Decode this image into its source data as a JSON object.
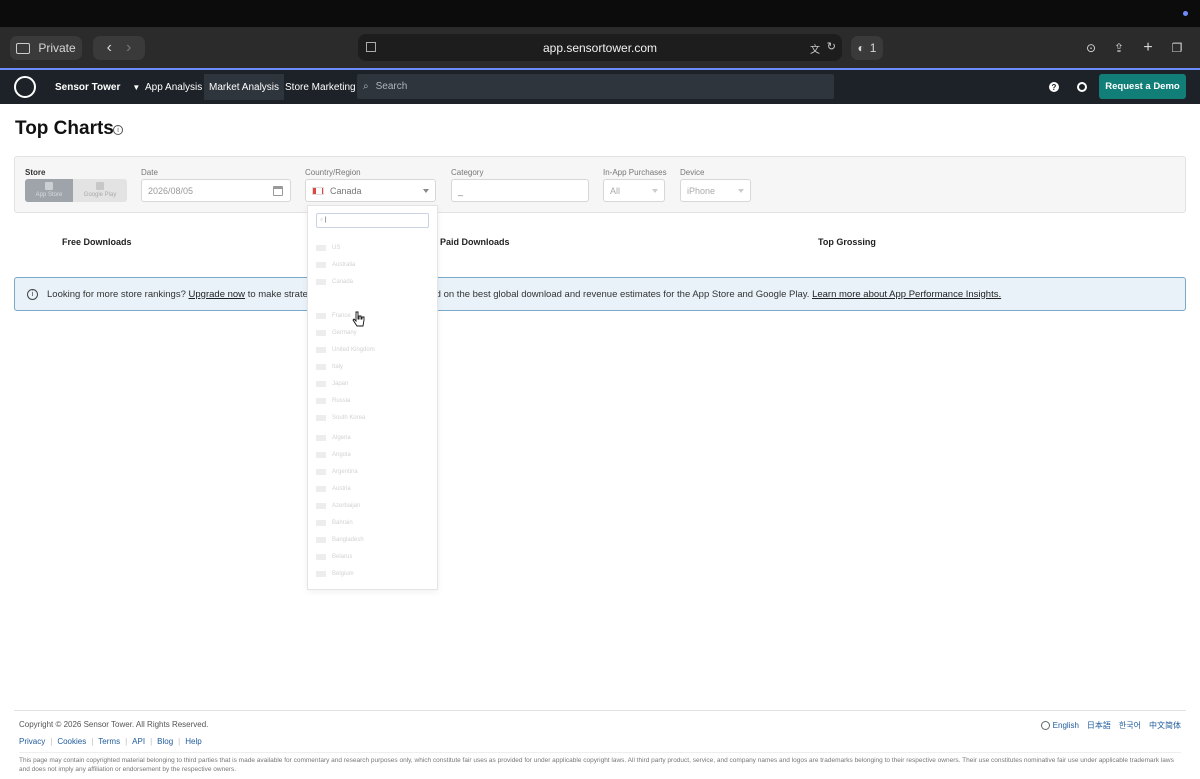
{
  "browser": {
    "private_label": "Private",
    "url": "app.sensortower.com",
    "tab_count": "1"
  },
  "nav": {
    "brand": "Sensor Tower",
    "items": [
      "App Analysis",
      "Market Analysis",
      "Store Marketing"
    ],
    "search_placeholder": "Search",
    "demo_button": "Request a Demo"
  },
  "page": {
    "title": "Top Charts"
  },
  "filters": {
    "store_label": "Store",
    "store_options": [
      "App Store",
      "Google Play"
    ],
    "date_label": "Date",
    "date_value": "2026/08/05",
    "country_label": "Country/Region",
    "country_value": "Canada",
    "category_label": "Category",
    "category_value": "_",
    "iap_label": "In-App Purchases",
    "iap_value": "All",
    "device_label": "Device",
    "device_value": "iPhone"
  },
  "country_dropdown": {
    "search_value": "|",
    "options": [
      "US",
      "Australia",
      "Canada",
      "France",
      "Germany",
      "United Kingdom",
      "Italy",
      "Japan",
      "Russia",
      "South Korea",
      "Algeria",
      "Angola",
      "Argentina",
      "Austria",
      "Azerbaijan",
      "Bahrain",
      "Bangladesh",
      "Belarus",
      "Belgium"
    ]
  },
  "tabs": [
    "Free Downloads",
    "Paid Downloads",
    "Top Grossing"
  ],
  "banner": {
    "lead": "Looking for more store rankings?",
    "link1": "Upgrade now",
    "middle": "to make strategic data-driven decisions based on the best global download and revenue estimates for the App Store and Google Play.",
    "link2": "Learn more about App Performance Insights."
  },
  "footer": {
    "copyright": "Copyright © 2026 Sensor Tower. All Rights Reserved.",
    "links": [
      "Privacy",
      "Cookies",
      "Terms",
      "API",
      "Blog",
      "Help"
    ],
    "languages": [
      "English",
      "日本語",
      "한국어",
      "中文简体"
    ],
    "legal": "This page may contain copyrighted material belonging to third parties that is made available for commentary and research purposes only, which constitute fair uses as provided for under applicable copyright laws. All third party product, service, and company names and logos are trademarks belonging to their respective owners. Their use constitutes nominative fair use under applicable trademark laws and does not imply any affiliation or endorsement by the respective owners."
  },
  "colors": {
    "nav_bg": "#1d2228",
    "demo_button": "#117f78",
    "banner_bg": "#e9f2f8",
    "accent": "#6f8cff"
  }
}
